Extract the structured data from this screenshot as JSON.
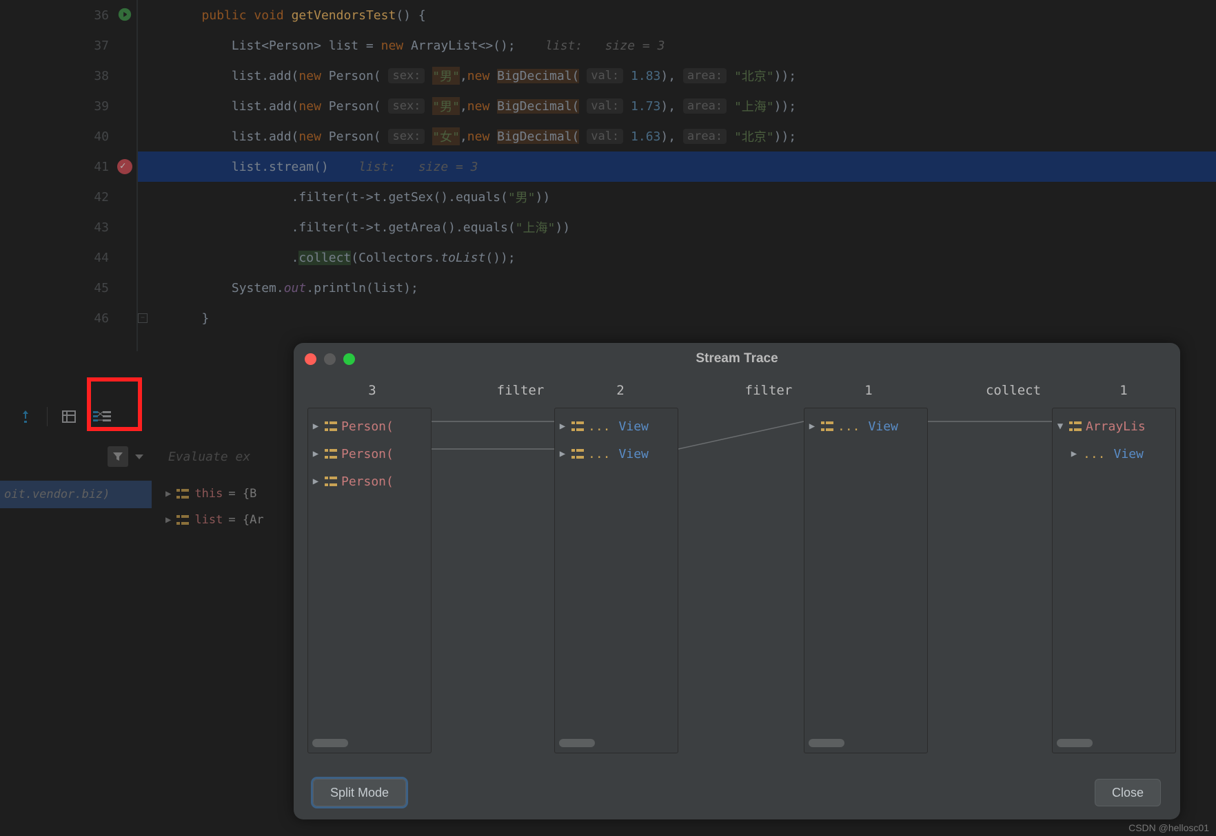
{
  "editor": {
    "lines": [
      {
        "n": 36
      },
      {
        "n": 37
      },
      {
        "n": 38
      },
      {
        "n": 39
      },
      {
        "n": 40
      },
      {
        "n": 41
      },
      {
        "n": 42
      },
      {
        "n": 43
      },
      {
        "n": 44
      },
      {
        "n": 45
      },
      {
        "n": 46
      }
    ],
    "code": {
      "l36_kw1": "public",
      "l36_kw2": "void",
      "l36_name": "getVendorsTest",
      "l36_tail": "() {",
      "l37_a": "List<Person> list = ",
      "l37_new": "new ",
      "l37_b": "ArrayList<>();",
      "l37_hint_a": "list:",
      "l37_hint_b": "size = 3",
      "l38_a": "list.add(",
      "l38_new": "new ",
      "l38_b": "Person(",
      "l38_h1": "sex:",
      "l38_s1": "\"男\"",
      "l38_c": ",",
      "l38_new2": "new ",
      "l38_d": "BigDecimal(",
      "l38_h2": "val:",
      "l38_n": "1.83",
      "l38_e": "),",
      "l38_h3": "area:",
      "l38_s2": "\"北京\"",
      "l38_f": "));",
      "l39_a": "list.add(",
      "l39_new": "new ",
      "l39_b": "Person(",
      "l39_h1": "sex:",
      "l39_s1": "\"男\"",
      "l39_c": ",",
      "l39_new2": "new ",
      "l39_d": "BigDecimal(",
      "l39_h2": "val:",
      "l39_n": "1.73",
      "l39_e": "),",
      "l39_h3": "area:",
      "l39_s2": "\"上海\"",
      "l39_f": "));",
      "l40_a": "list.add(",
      "l40_new": "new ",
      "l40_b": "Person(",
      "l40_h1": "sex:",
      "l40_s1": "\"女\"",
      "l40_c": ",",
      "l40_new2": "new ",
      "l40_d": "BigDecimal(",
      "l40_h2": "val:",
      "l40_n": "1.63",
      "l40_e": "),",
      "l40_h3": "area:",
      "l40_s2": "\"北京\"",
      "l40_f": "));",
      "l41_a": "list.stream()",
      "l41_hint_a": "list:",
      "l41_hint_b": "size = 3",
      "l42_a": ".filter(t->t.getSex().equals(",
      "l42_s": "\"男\"",
      "l42_b": "))",
      "l43_a": ".filter(t->t.getArea().equals(",
      "l43_s": "\"上海\"",
      "l43_b": "))",
      "l44_a": ".",
      "l44_hl": "collect",
      "l44_b": "(Collectors.",
      "l44_i": "toList",
      "l44_c": "());",
      "l45_a": "System.",
      "l45_i": "out",
      "l45_b": ".println(list);",
      "l46_a": "}"
    }
  },
  "debugger": {
    "eval_placeholder": "Evaluate ex",
    "frame": "oit.vendor.biz)",
    "vars": [
      {
        "name": "this",
        "val": " = {B"
      },
      {
        "name": "list",
        "val": " = {Ar"
      }
    ]
  },
  "dialog": {
    "title": "Stream Trace",
    "stages": {
      "count1": "3",
      "op1": "filter",
      "count2": "2",
      "op2": "filter",
      "count3": "1",
      "op3": "collect",
      "count4": "1"
    },
    "panel1": [
      "Person(",
      "Person(",
      "Person("
    ],
    "panel2": [
      {
        "dots": "...",
        "link": "View"
      },
      {
        "dots": "...",
        "link": "View"
      }
    ],
    "panel3": [
      {
        "dots": "...",
        "link": "View"
      }
    ],
    "panel4": {
      "head": "ArrayLis",
      "child": {
        "dots": "...",
        "link": "View"
      }
    },
    "split_btn": "Split Mode",
    "close_btn": "Close"
  },
  "watermark": "CSDN @hellosc01"
}
